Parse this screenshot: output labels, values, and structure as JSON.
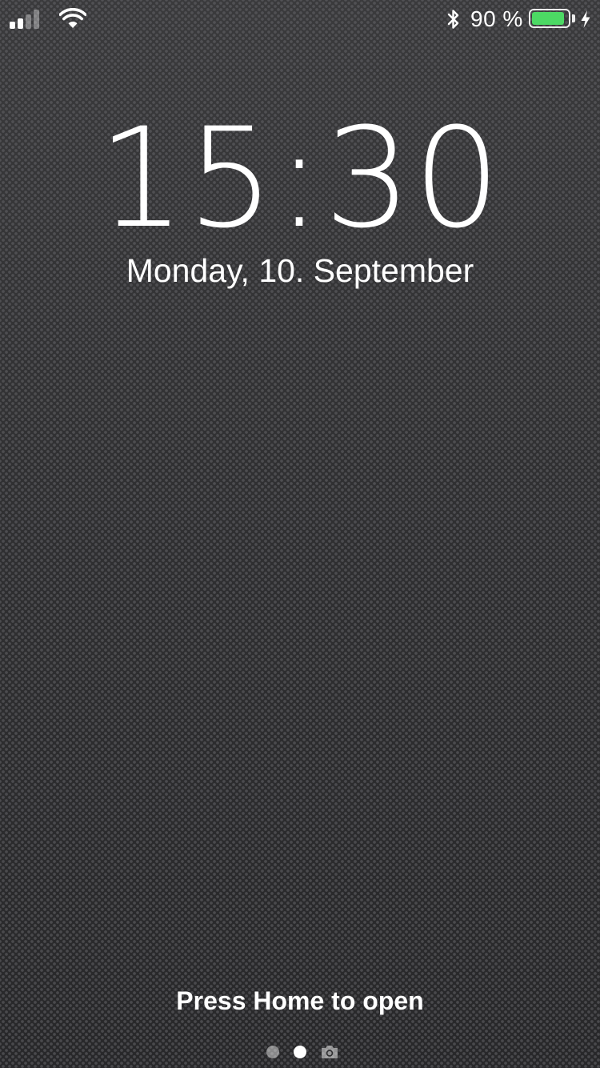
{
  "status_bar": {
    "signal_icon": "cellular-signal-icon",
    "wifi_icon": "wifi-icon",
    "bluetooth_icon": "bluetooth-icon",
    "battery_percent_text": "90 %",
    "battery_level": 0.9,
    "battery_color": "#4cd964",
    "charging_icon": "charging-bolt-icon"
  },
  "lock_screen": {
    "time": "15:30",
    "date": "Monday, 10. September",
    "unlock_hint": "Press Home to open"
  },
  "pager": {
    "page_count": 2,
    "current_page": 2,
    "camera_icon": "camera-icon"
  }
}
